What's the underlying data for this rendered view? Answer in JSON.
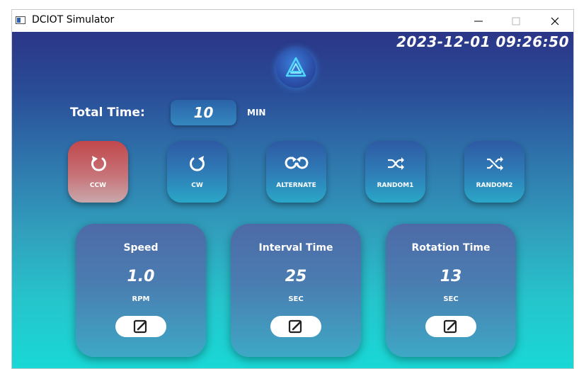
{
  "window": {
    "title": "DCIOT Simulator",
    "controls": [
      "minimize-icon",
      "maximize-icon",
      "close-icon"
    ]
  },
  "header": {
    "datetime": "2023-12-01 09:26:50",
    "logo_icon": "triangle-logo-icon"
  },
  "total_time": {
    "label": "Total Time:",
    "value": "10",
    "unit": "MIN"
  },
  "modes": [
    {
      "label": "CCW",
      "icon": "rotate-ccw-icon",
      "active": true
    },
    {
      "label": "CW",
      "icon": "rotate-cw-icon",
      "active": false
    },
    {
      "label": "ALTERNATE",
      "icon": "alternate-icon",
      "active": false
    },
    {
      "label": "RANDOM1",
      "icon": "shuffle-icon",
      "active": false
    },
    {
      "label": "RANDOM2",
      "icon": "shuffle-icon",
      "active": false
    }
  ],
  "cards": [
    {
      "title": "Speed",
      "value": "1.0",
      "unit": "RPM",
      "icon": "edit-icon"
    },
    {
      "title": "Interval Time",
      "value": "25",
      "unit": "SEC",
      "icon": "edit-icon"
    },
    {
      "title": "Rotation Time",
      "value": "13",
      "unit": "SEC",
      "icon": "edit-icon"
    }
  ],
  "colors": {
    "active_mode": "#c0484c",
    "background_top": "#2b3687",
    "background_bottom": "#19d8d6"
  }
}
